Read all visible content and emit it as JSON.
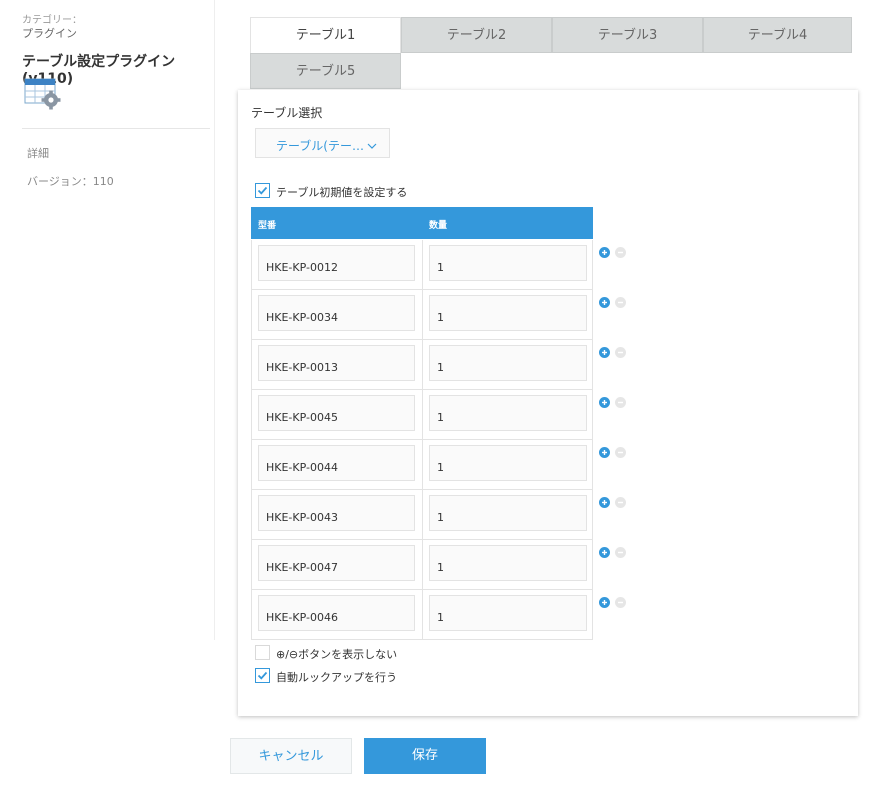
{
  "sidebar": {
    "category_label": "カテゴリー：",
    "category_value": "プラグイン",
    "plugin_name": "テーブル設定プラグイン(v110)",
    "icon": "table-gear-icon",
    "detail_label": "詳細",
    "version_label": "バージョン：110"
  },
  "tabs": [
    {
      "label": "テーブル1",
      "active": true
    },
    {
      "label": "テーブル2",
      "active": false
    },
    {
      "label": "テーブル3",
      "active": false
    },
    {
      "label": "テーブル4",
      "active": false
    },
    {
      "label": "テーブル5",
      "active": false
    }
  ],
  "panel": {
    "select_title": "テーブル選択",
    "select_value": "テーブル(テー…",
    "init_checkbox": {
      "label": "テーブル初期値を設定する",
      "checked": true
    },
    "table": {
      "headers": [
        "型番",
        "数量"
      ],
      "rows": [
        [
          "HKE-KP-0012",
          "1"
        ],
        [
          "HKE-KP-0034",
          "1"
        ],
        [
          "HKE-KP-0013",
          "1"
        ],
        [
          "HKE-KP-0045",
          "1"
        ],
        [
          "HKE-KP-0044",
          "1"
        ],
        [
          "HKE-KP-0043",
          "1"
        ],
        [
          "HKE-KP-0047",
          "1"
        ],
        [
          "HKE-KP-0046",
          "1"
        ]
      ]
    },
    "hide_buttons_checkbox": {
      "label": "⊕/⊖ボタンを表示しない",
      "checked": false
    },
    "auto_lookup_checkbox": {
      "label": "自動ルックアップを行う",
      "checked": true
    }
  },
  "buttons": {
    "cancel_label": "キャンセル",
    "save_label": "保存"
  },
  "colors": {
    "accent": "#3498db",
    "tab_inactive": "#d8dbdb",
    "border": "#e3e3e3"
  }
}
